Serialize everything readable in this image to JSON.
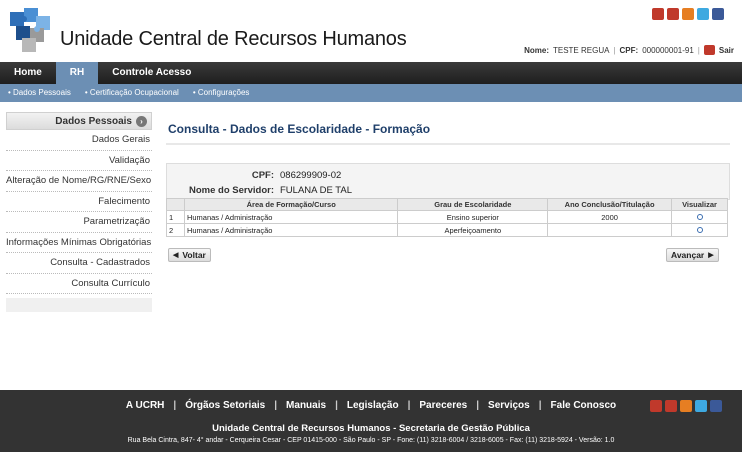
{
  "header": {
    "title": "Unidade Central de Recursos Humanos",
    "social_icons": [
      "youtube-icon",
      "vimeo-icon",
      "blogger-icon",
      "twitter-icon",
      "facebook-icon"
    ],
    "user_label": "Nome:",
    "user_name": "TESTE REGUA",
    "cpf_label": "CPF:",
    "cpf_value": "000000001-91",
    "exit_label": "Sair"
  },
  "topnav": [
    "Home",
    "RH",
    "Controle Acesso"
  ],
  "subnav": [
    "Dados Pessoais",
    "Certificação Ocupacional",
    "Configurações"
  ],
  "sidebar": {
    "header": "Dados Pessoais",
    "items": [
      "Dados Gerais",
      "Validação",
      "Alteração de Nome/RG/RNE/Sexo",
      "Falecimento",
      "Parametrização",
      "Informações Mínimas Obrigatórias",
      "Consulta - Cadastrados",
      "Consulta Currículo"
    ]
  },
  "main": {
    "title": "Consulta - Dados de Escolaridade - Formação",
    "cpf_label": "CPF:",
    "cpf_value": "086299909-02",
    "server_label": "Nome do Servidor:",
    "server_value": "FULANA DE TAL",
    "table": {
      "headers": [
        "",
        "Área de Formação/Curso",
        "Grau de Escolaridade",
        "Ano Conclusão/Titulação",
        "Visualizar"
      ],
      "rows": [
        {
          "n": "1",
          "area": "Humanas / Administração",
          "grau": "Ensino superior",
          "ano": "2000"
        },
        {
          "n": "2",
          "area": "Humanas / Administração",
          "grau": "Aperfeiçoamento",
          "ano": ""
        }
      ]
    },
    "back_label": "Voltar",
    "next_label": "Avançar"
  },
  "footer": {
    "links": [
      "A UCRH",
      "Órgãos Setoriais",
      "Manuais",
      "Legislação",
      "Pareceres",
      "Serviços",
      "Fale Conosco"
    ],
    "org": "Unidade Central de Recursos Humanos - Secretaria de Gestão Pública",
    "address": "Rua Bela Cintra, 847- 4° andar - Cerqueira Cesar - CEP 01415-000 - São Paulo - SP - Fone: (11) 3218-6004 / 3218-6005 - Fax: (11) 3218-5924 - Versão: 1.0"
  },
  "colors": {
    "accent": "#6c8fb4",
    "title": "#1f3f6a",
    "footer_bg": "#333333",
    "topnav_bg": "#2a2a2a"
  }
}
